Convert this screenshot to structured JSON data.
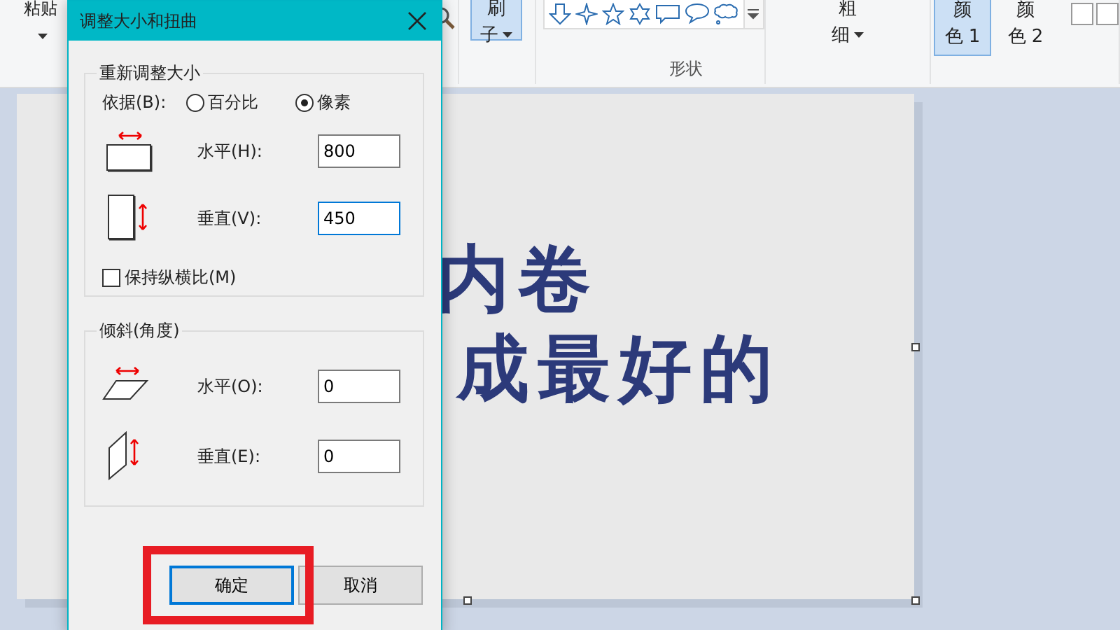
{
  "ribbon": {
    "paste": {
      "label": "粘贴"
    },
    "brush": {
      "label": "刷子",
      "selected": true
    },
    "shapes_group": {
      "label": "形状"
    },
    "size": {
      "label": "粗细"
    },
    "colors": [
      {
        "label": "颜色 1",
        "selected": true
      },
      {
        "label": "颜色 2",
        "selected": false
      }
    ]
  },
  "canvas": {
    "lines": [
      "内卷",
      "成最好的"
    ]
  },
  "dialog": {
    "title": "调整大小和扭曲",
    "resize": {
      "title": "重新调整大小",
      "by_label": "依据(B):",
      "options": [
        {
          "label": "百分比",
          "selected": false
        },
        {
          "label": "像素",
          "selected": true
        }
      ],
      "fields": [
        {
          "label": "水平(H):",
          "value": "800",
          "focused": false
        },
        {
          "label": "垂直(V):",
          "value": "450",
          "focused": true
        }
      ],
      "keep_ratio": {
        "label": "保持纵横比(M)",
        "checked": false
      }
    },
    "skew": {
      "title": "倾斜(角度)",
      "fields": [
        {
          "label": "水平(O):",
          "value": "0",
          "focused": false
        },
        {
          "label": "垂直(E):",
          "value": "0",
          "focused": false
        }
      ]
    },
    "buttons": [
      {
        "label": "确定",
        "default": true,
        "highlighted": true
      },
      {
        "label": "取消",
        "default": false,
        "highlighted": false
      }
    ]
  }
}
